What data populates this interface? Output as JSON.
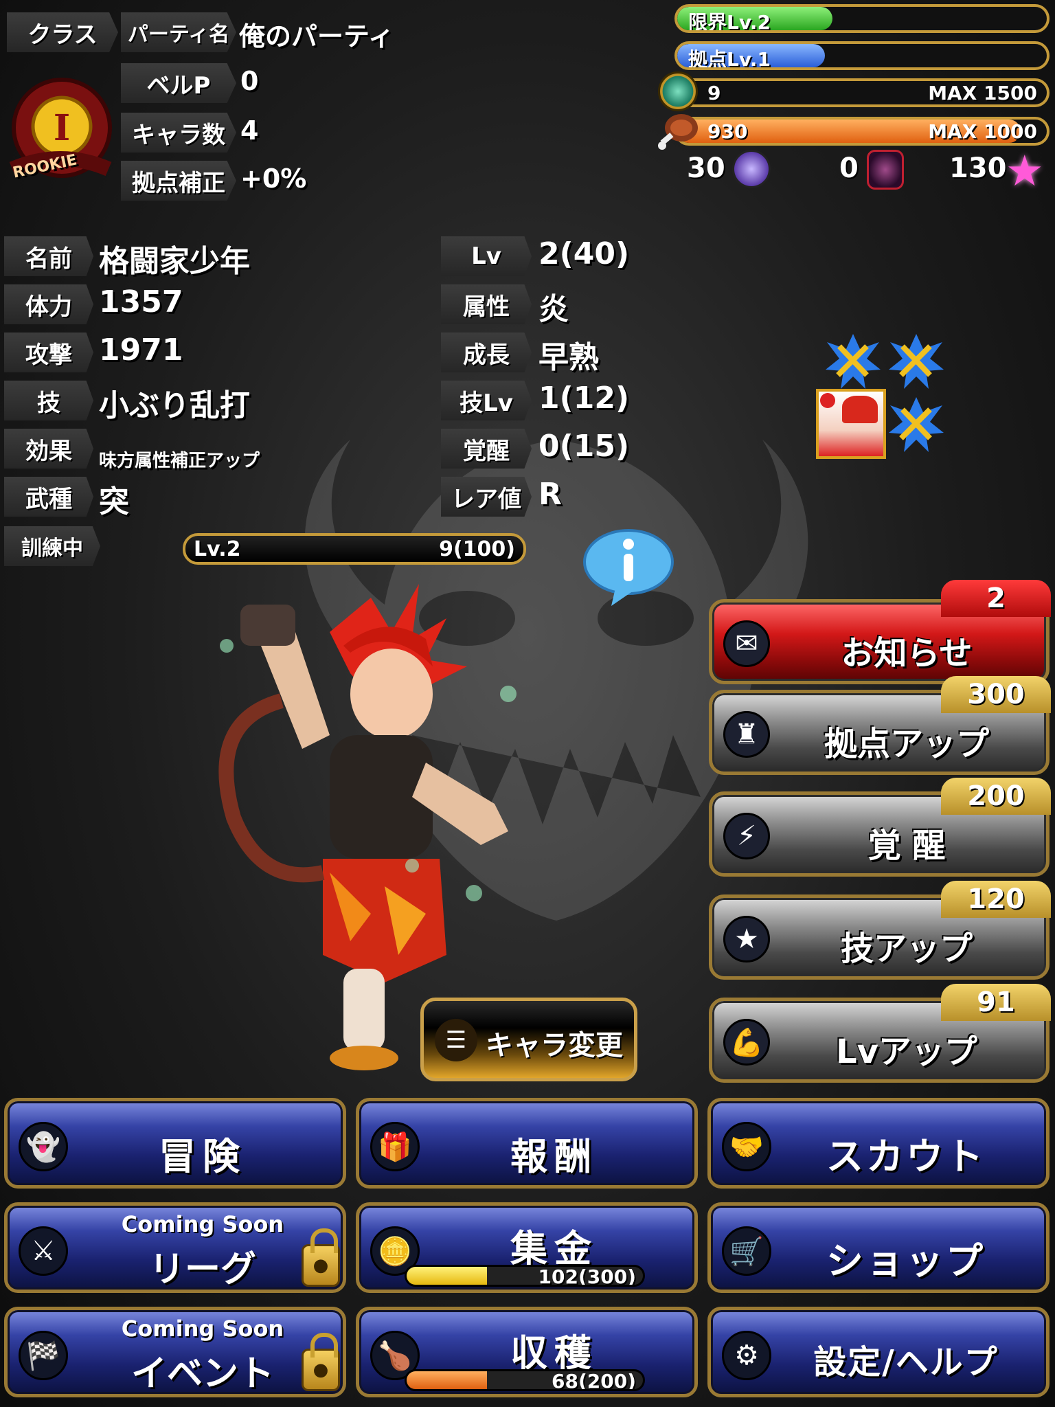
{
  "class_label": "クラス",
  "party_label": "パーティ名",
  "party_name": "俺のパーティ",
  "emblem_text": "ROOKIE",
  "belp_label": "ベルP",
  "belp_value": "0",
  "chara_count_label": "キャラ数",
  "chara_count_value": "4",
  "base_bonus_label": "拠点補正",
  "base_bonus_value": "+0%",
  "bars": {
    "limit": {
      "label": "限界Lv.2",
      "progress": 0.42,
      "color": "#3fc23a"
    },
    "base": {
      "label": "拠点Lv.1",
      "progress": 0.4,
      "color": "#3a7ae8"
    },
    "coin": {
      "value": "9",
      "max": "MAX 1500",
      "progress": 0.01
    },
    "meat": {
      "value": "930",
      "max": "MAX 1000",
      "progress": 0.93,
      "color": "#f07a18"
    }
  },
  "currencies": {
    "orb": "30",
    "demon": "0",
    "star": "130"
  },
  "stats_left": [
    {
      "label": "名前",
      "value": "格闘家少年"
    },
    {
      "label": "体力",
      "value": "1357"
    },
    {
      "label": "攻撃",
      "value": "1971"
    },
    {
      "label": "技",
      "value": "小ぶり乱打"
    },
    {
      "label": "効果",
      "value": "味方属性補正アップ"
    },
    {
      "label": "武種",
      "value": "突"
    }
  ],
  "stats_right": [
    {
      "label": "Lv",
      "value": "2(40)"
    },
    {
      "label": "属性",
      "value": "炎"
    },
    {
      "label": "成長",
      "value": "早熟"
    },
    {
      "label": "技Lv",
      "value": "1(12)"
    },
    {
      "label": "覚醒",
      "value": "0(15)"
    },
    {
      "label": "レア値",
      "value": "R"
    }
  ],
  "training": {
    "label": "訓練中",
    "level": "Lv.2",
    "progress_text": "9(100)",
    "progress": 0.09
  },
  "right_buttons": [
    {
      "label": "お知らせ",
      "badge": "2",
      "icon": "envelope-icon"
    },
    {
      "label": "拠点アップ",
      "badge": "300",
      "icon": "castle-icon"
    },
    {
      "label": "覚 醒",
      "badge": "200",
      "icon": "lightning-icon"
    },
    {
      "label": "技アップ",
      "badge": "120",
      "icon": "star-icon"
    },
    {
      "label": "Lvアップ",
      "badge": "91",
      "icon": "muscle-icon"
    }
  ],
  "chara_change_label": "キャラ変更",
  "bottom_buttons": {
    "adventure": "冒険",
    "reward": "報酬",
    "scout": "スカウト",
    "league_soon": "Coming Soon",
    "league": "リーグ",
    "collect": "集金",
    "collect_progress": "102(300)",
    "collect_ratio": 0.34,
    "shop": "ショップ",
    "event_soon": "Coming Soon",
    "event": "イベント",
    "harvest": "収穫",
    "harvest_progress": "68(200)",
    "harvest_ratio": 0.34,
    "settings": "設定/ヘルプ"
  },
  "colors": {
    "gold_border": "#9a7a34",
    "button_blue": "#3543a6",
    "button_red": "#d31818",
    "badge_gold": "#e0b84a"
  }
}
